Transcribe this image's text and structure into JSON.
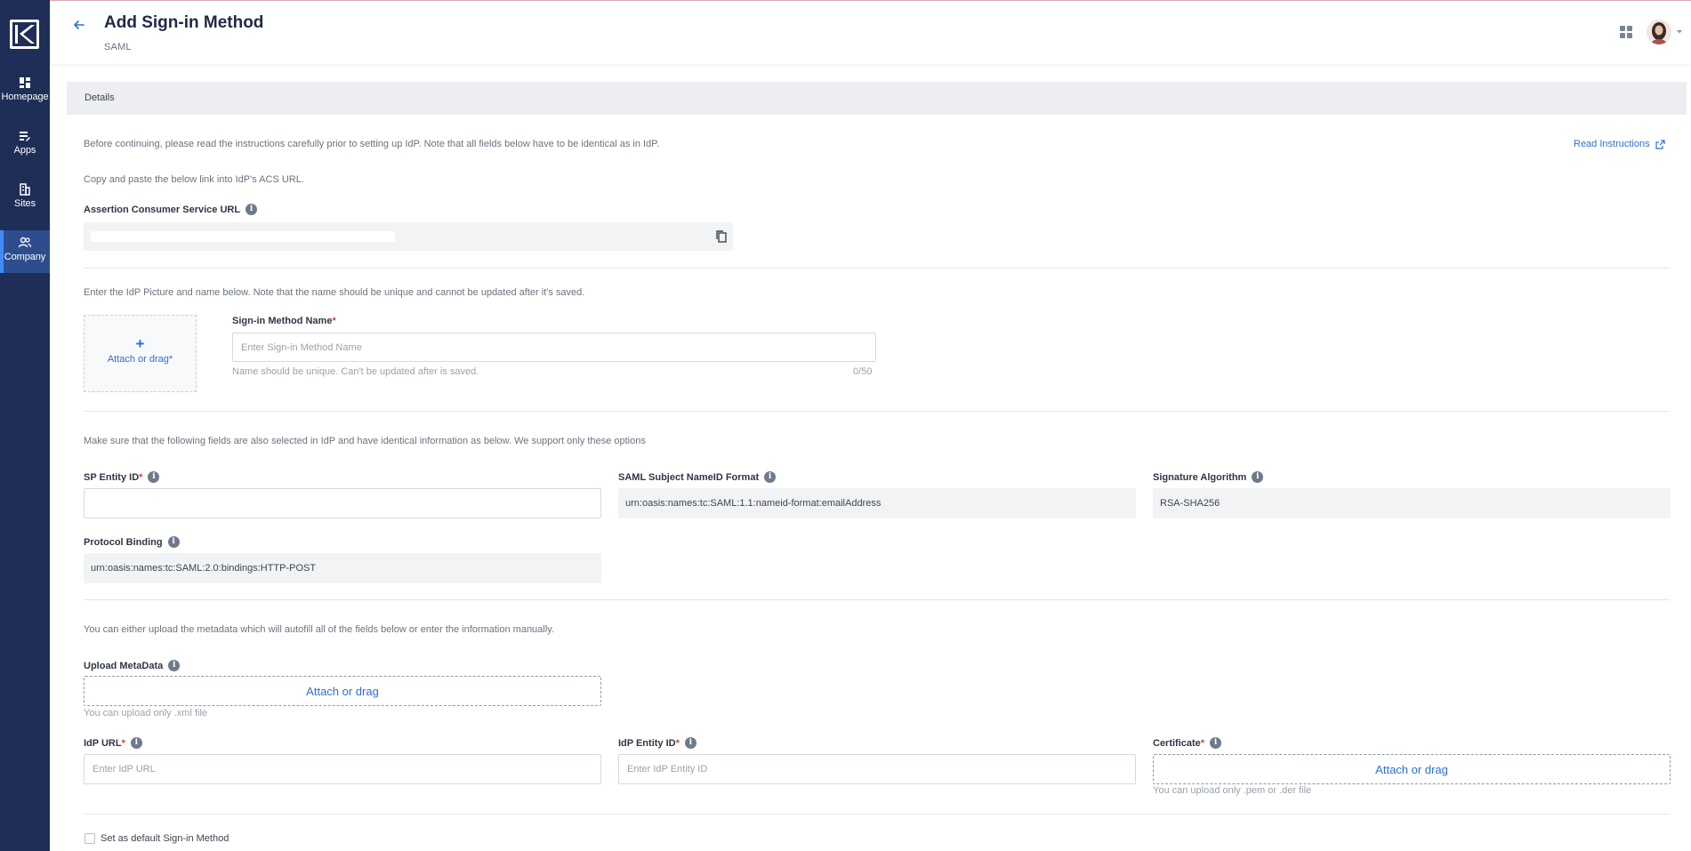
{
  "nav": {
    "items": [
      {
        "label": "Homepage",
        "icon": "dashboard-icon"
      },
      {
        "label": "Apps",
        "icon": "apps-list-icon"
      },
      {
        "label": "Sites",
        "icon": "building-icon"
      },
      {
        "label": "Company",
        "icon": "people-icon",
        "active": true
      }
    ]
  },
  "header": {
    "title": "Add Sign-in Method",
    "subtitle": "SAML"
  },
  "panel": {
    "title": "Details"
  },
  "intro": {
    "text": "Before continuing, please read the instructions carefully prior to setting up IdP. Note that all fields below have to be identical as in IdP.",
    "read_instructions": "Read Instructions"
  },
  "acs": {
    "copy_text": "Copy and paste the below link into IdP's ACS URL.",
    "label": "Assertion Consumer Service URL"
  },
  "idp_picture": {
    "text": "Enter the IdP Picture and name below. Note that the name should be unique and cannot be updated after it's saved.",
    "plus": "+",
    "attach_label": "Attach or drag*",
    "name_label": "Sign-in Method Name",
    "name_required": "*",
    "name_placeholder": "Enter Sign-in Method Name",
    "name_help": "Name should be unique. Can't be updated after is saved.",
    "name_counter": "0/50"
  },
  "sp_section": {
    "text": "Make sure that the following fields are also selected in IdP and have identical information as below. We support only these options",
    "sp_entity_label": "SP Entity ID",
    "sp_entity_required": "*",
    "sp_entity_value": "",
    "nameid_label": "SAML Subject NameID Format",
    "nameid_value": "urn:oasis:names:tc:SAML:1.1:nameid-format:emailAddress",
    "signature_label": "Signature Algorithm",
    "signature_value": "RSA-SHA256",
    "binding_label": "Protocol Binding",
    "binding_value": "urn:oasis:names:tc:SAML:2.0:bindings:HTTP-POST"
  },
  "metadata": {
    "text": "You can either upload the metadata which will autofill all of the fields below or enter the information manually.",
    "upload_label": "Upload MetaData",
    "attach_label": "Attach or drag",
    "upload_help": "You can upload only .xml file",
    "idp_url_label": "IdP URL",
    "idp_url_required": "*",
    "idp_url_placeholder": "Enter IdP URL",
    "idp_entity_label": "IdP Entity ID",
    "idp_entity_required": "*",
    "idp_entity_placeholder": "Enter IdP Entity ID",
    "cert_label": "Certificate",
    "cert_required": "*",
    "cert_attach": "Attach or drag",
    "cert_help": "You can upload only .pem or .der file"
  },
  "default_method": {
    "label": "Set as default Sign-in Method",
    "checked": false
  },
  "colors": {
    "sidebar": "#1e2e57",
    "accent": "#2f6fd1",
    "active_nav": "#2e4d8f"
  }
}
